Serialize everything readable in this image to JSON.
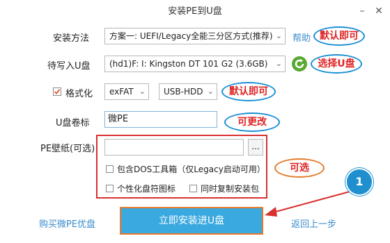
{
  "window": {
    "title": "安装PE到U盘",
    "minimize": "–",
    "close": "✕"
  },
  "install_method": {
    "label": "安装方法",
    "value": "方案一: UEFI/Legacy全能三分区方式(推荐)",
    "help": "帮助"
  },
  "target_usb": {
    "label": "待写入U盘",
    "value": "(hd1)F: I: Kingston DT 101 G2 (3.6GB)"
  },
  "format": {
    "label": "格式化",
    "checked": true,
    "fs": "exFAT",
    "mode": "USB-HDD"
  },
  "volume": {
    "label": "U盘卷标",
    "value": "微PE"
  },
  "wallpaper": {
    "label": "PE壁纸(可选)",
    "value": "",
    "browse": "..."
  },
  "options": {
    "dos_tools": "包含DOS工具箱（仅Legacy启动可用）",
    "custom_icon": "个性化盘符图标",
    "copy_pkg": "同时复制安装包"
  },
  "annotations": {
    "default1": "默认即可",
    "select_usb": "选择U盘",
    "default2": "默认即可",
    "changeable": "可更改",
    "optional": "可选",
    "step": "1"
  },
  "footer": {
    "buy": "购买微PE优盘",
    "install": "立即安装进U盘",
    "back": "返回上一步"
  },
  "colors": {
    "accent": "#3aa9e0",
    "annotation_red": "#e02424",
    "bubble_blue": "#1a8fd6",
    "box_red": "#d93030",
    "step_badge": "#1f8fcf"
  }
}
